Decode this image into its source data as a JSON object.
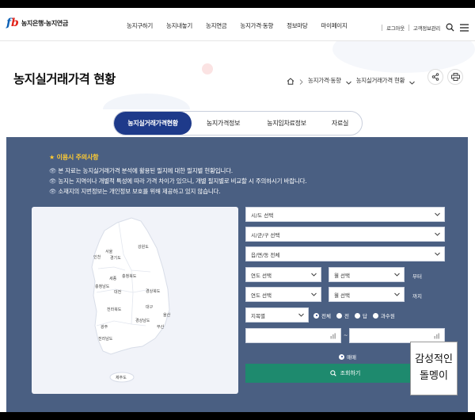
{
  "header": {
    "logo_mark_f": "f",
    "logo_mark_b": "b",
    "logo_text": "농지은행·농지연금",
    "nav": [
      "농지구하기",
      "농지내놓기",
      "농지연금",
      "농지가격·동향",
      "정보마당",
      "마이페이지"
    ],
    "login": "로그아웃",
    "customer": "고객정보관리"
  },
  "page": {
    "title": "농지실거래가격 현황",
    "breadcrumb": [
      "농지가격·동향",
      "농지실거래가격 현황"
    ]
  },
  "tabs": [
    "농지실거래가격현황",
    "농지가격정보",
    "농지임차료정보",
    "자료실"
  ],
  "notice": {
    "title": "이용시 주의사항",
    "lines": [
      "본 자료는 농지실거래가격 분석에 활용된 필지에 대한 필지별 현황입니다.",
      "농지는 지역이나 개별적 특성에 따라 가격 차이가 있으니, 개별 필지별로 비교할 시 주의하시기 바랍니다.",
      "소재지의 지번정보는 개인정보 보호를 위해 제공하고 있지 않습니다."
    ]
  },
  "map_labels": [
    "서울",
    "인천",
    "경기도",
    "강원도",
    "충청북도",
    "충청남도",
    "세종",
    "대전",
    "경상북도",
    "전라북도",
    "대구",
    "경상남도",
    "울산",
    "광주",
    "부산",
    "전라남도",
    "제주도"
  ],
  "form": {
    "sido": "시/도 선택",
    "sigungu": "시/군/구 선택",
    "eupmyeon": "읍/면/동 전체",
    "year_from": "연도 선택",
    "month_from": "월 선택",
    "from_label": "부터",
    "year_to": "연도 선택",
    "month_to": "월 선택",
    "to_label": "까지",
    "jimok": "지목별",
    "jimok_options": [
      "전체",
      "전",
      "답",
      "과수원"
    ],
    "range_sep": "~",
    "trade": "매매",
    "search": "조회하기"
  },
  "watermark": [
    "감성적인",
    "돌멩이"
  ],
  "colors": {
    "brand_blue": "#1e3a8a",
    "panel": "#4a5f82",
    "search_green": "#1e8a6e",
    "notice_yellow": "#ffcc33"
  }
}
